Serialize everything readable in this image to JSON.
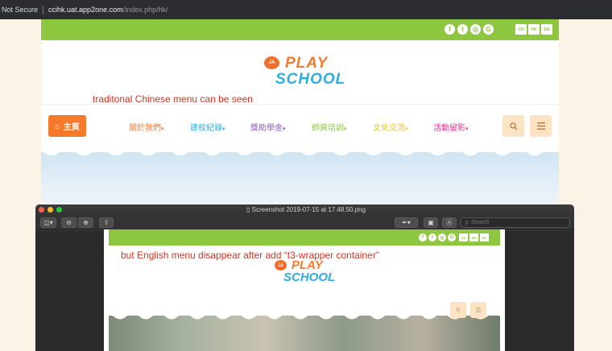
{
  "browser": {
    "security_label": "Not Secure",
    "url_host": "ccihk.uat.app2one.com",
    "url_path": "/index.php/hk/"
  },
  "site": {
    "social_icons": [
      "f",
      "t",
      "◎",
      "G"
    ],
    "languages": [
      "CN",
      "HK",
      "EN"
    ],
    "logo": {
      "badge": "JA",
      "line1": "PLAY",
      "line2": "SCHOOL"
    },
    "annotation": "traditonal Chinese menu can be seen",
    "home_label": "主頁",
    "menu": [
      {
        "label": "關於我們",
        "color": "#f57a2b"
      },
      {
        "label": "建校紀錄",
        "color": "#2eaee0"
      },
      {
        "label": "獎助學金",
        "color": "#8e5fb5"
      },
      {
        "label": "師資培訓",
        "color": "#8dc63f"
      },
      {
        "label": "文化交流",
        "color": "#f4c21b"
      },
      {
        "label": "活動留影",
        "color": "#e8378f"
      }
    ],
    "caret": "▾",
    "brand_green": "#8dc63f",
    "brand_orange": "#f57a2b"
  },
  "preview": {
    "window_title": "Screenshot 2019-07-15 at 17.48.50.png",
    "search_placeholder": "Search",
    "annotation": "but English menu disappear after add  “t3-wrapper container”",
    "logo": {
      "badge": "JA",
      "line1": "PLAY",
      "line2": "SCHOOL"
    },
    "social_icons": [
      "f",
      "t",
      "◎",
      "G"
    ],
    "languages": [
      "CN",
      "HK",
      "EN"
    ]
  }
}
